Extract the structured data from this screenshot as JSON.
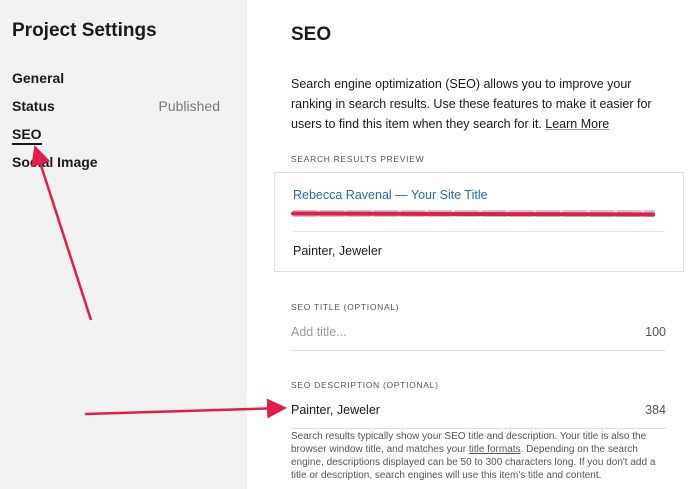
{
  "sidebar": {
    "title": "Project Settings",
    "items": [
      {
        "label": "General"
      },
      {
        "label": "Status",
        "value": "Published"
      },
      {
        "label": "SEO"
      },
      {
        "label": "Social Image"
      }
    ]
  },
  "main": {
    "title": "SEO",
    "description": "Search engine optimization (SEO) allows you to improve your ranking in search results. Use these features to make it easier for users to find this item when they search for it. ",
    "learn_more": "Learn More",
    "preview": {
      "label": "SEARCH RESULTS PREVIEW",
      "title": "Rebecca Ravenal — Your Site Title",
      "description": "Painter, Jeweler"
    },
    "seo_title": {
      "label": "SEO TITLE (OPTIONAL)",
      "placeholder": "Add title...",
      "count": "100"
    },
    "seo_description": {
      "label": "SEO DESCRIPTION (OPTIONAL)",
      "value": "Painter, Jeweler",
      "count": "384",
      "help_before": "Search results typically show your SEO title and description. Your title is also the browser window title, and matches your ",
      "help_link": "title formats",
      "help_after": ". Depending on the search engine, descriptions displayed can be 50 to 300 characters long. If you don't add a title or description, search engines will use this item's title and content."
    }
  },
  "colors": {
    "sidebar_bg": "#f2f2f2",
    "link_blue": "#2a6ab5",
    "annotation_red": "#e11d48"
  }
}
